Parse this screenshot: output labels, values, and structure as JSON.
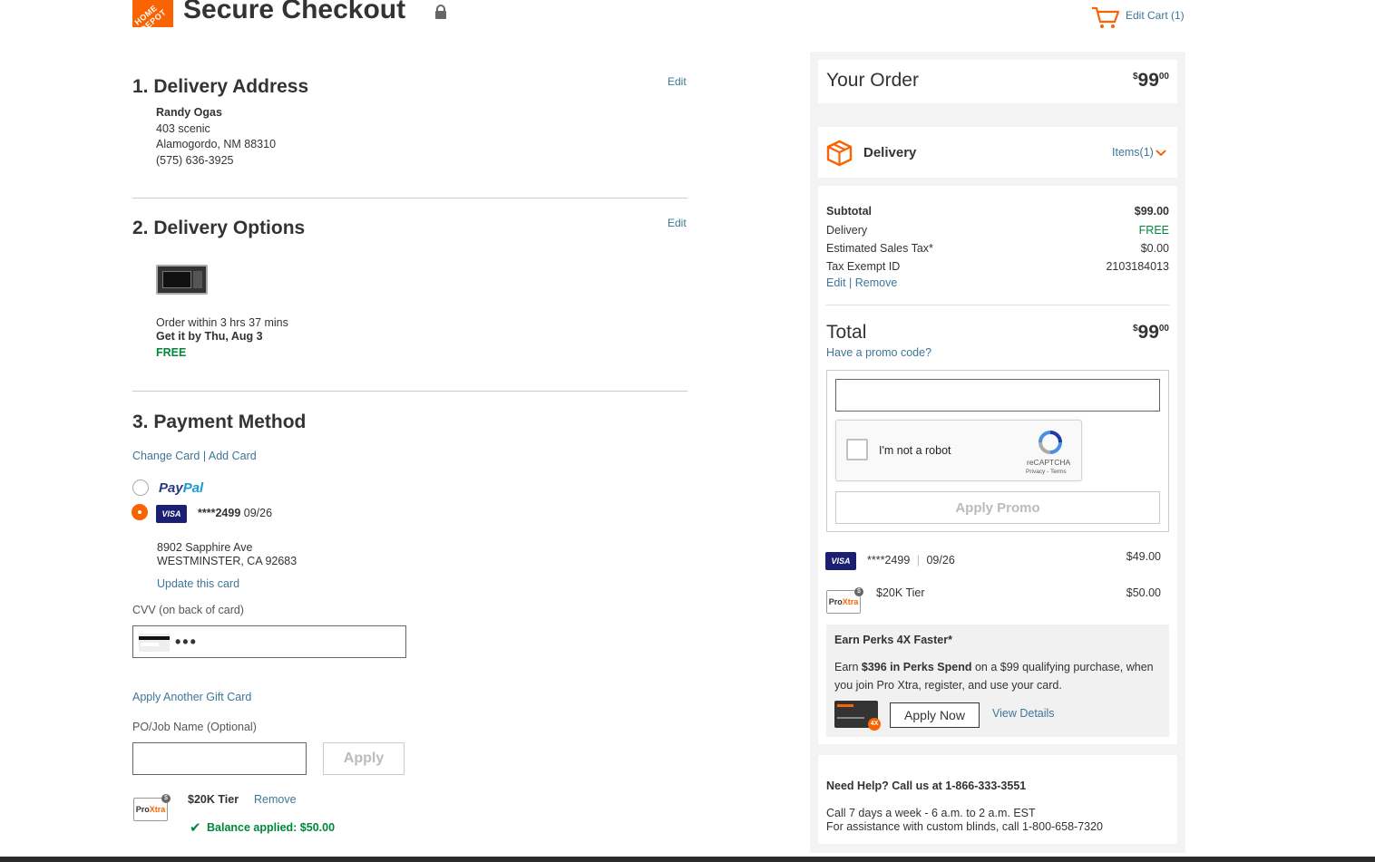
{
  "header": {
    "logo_text": "HOME DEPOT",
    "title": "Secure Checkout",
    "edit_cart": "Edit Cart (1)"
  },
  "delivery_address": {
    "title": "1. Delivery Address",
    "edit": "Edit",
    "name": "Randy Ogas",
    "street": "403 scenic",
    "city": "Alamogordo, NM 88310",
    "phone": "(575) 636-3925"
  },
  "delivery_options": {
    "title": "2. Delivery Options",
    "edit": "Edit",
    "order_within": "Order within 3 hrs 37 mins",
    "get_it_by": "Get it by Thu, Aug 3",
    "cost": "FREE"
  },
  "payment": {
    "title": "3. Payment Method",
    "change_card": "Change Card",
    "add_card": "Add Card",
    "separator": "|",
    "paypal_part1": "Pay",
    "paypal_part2": "Pal",
    "visa_label": "VISA",
    "card_masked": "****2499",
    "card_exp": "09/26",
    "billing_street": "8902 Sapphire Ave",
    "billing_city": "WESTMINSTER, CA 92683",
    "update_card": "Update this card",
    "cvv_label": "CVV (on back of card)",
    "cvv_value": "•••",
    "apply_gift_card": "Apply Another Gift Card",
    "po_label": "PO/Job Name (Optional)",
    "po_placeholder": "",
    "apply_button": "Apply",
    "tier_name": "$20K Tier",
    "tier_remove": "Remove",
    "balance_applied": "Balance applied: $50.00"
  },
  "order": {
    "title": "Your Order",
    "total_dollars": "99",
    "total_cents": "00",
    "delivery_label": "Delivery",
    "items_label": "Items(1)",
    "subtotal_label": "Subtotal",
    "subtotal_value": "$99.00",
    "delivery_row_label": "Delivery",
    "delivery_row_value": "FREE",
    "tax_label": "Estimated Sales Tax*",
    "tax_value": "$0.00",
    "tax_exempt_label": "Tax Exempt ID",
    "tax_exempt_value": "2103184013",
    "edit": "Edit",
    "remove": "Remove",
    "total_label": "Total",
    "promo_link": "Have a promo code?",
    "promo_placeholder": "",
    "captcha_label": "I'm not a robot",
    "captcha_brand": "reCAPTCHA",
    "captcha_links": "Privacy - Terms",
    "apply_promo": "Apply Promo",
    "pay_card_masked": "****2499",
    "pay_card_exp": "09/26",
    "pay_card_amount": "$49.00",
    "pay_tier": "$20K Tier",
    "pay_tier_amount": "$50.00",
    "perks_title": "Earn Perks 4X Faster*",
    "perks_text_pre": "Earn ",
    "perks_bold": "$396 in Perks Spend",
    "perks_text_post": " on a $99 qualifying purchase, when you join Pro Xtra, register, and use your card.",
    "apply_now": "Apply Now",
    "view_details": "View Details",
    "badge_4x": "4X"
  },
  "help": {
    "title": "Need Help? Call us at 1-866-333-3551",
    "hours": "Call 7 days a week - 6 a.m. to 2 a.m. EST",
    "blinds": "For assistance with custom blinds, call 1-800-658-7320"
  },
  "colors": {
    "brand": "#f96302",
    "link": "#3e7697",
    "success": "#00873c",
    "visa": "#1a1f71"
  }
}
